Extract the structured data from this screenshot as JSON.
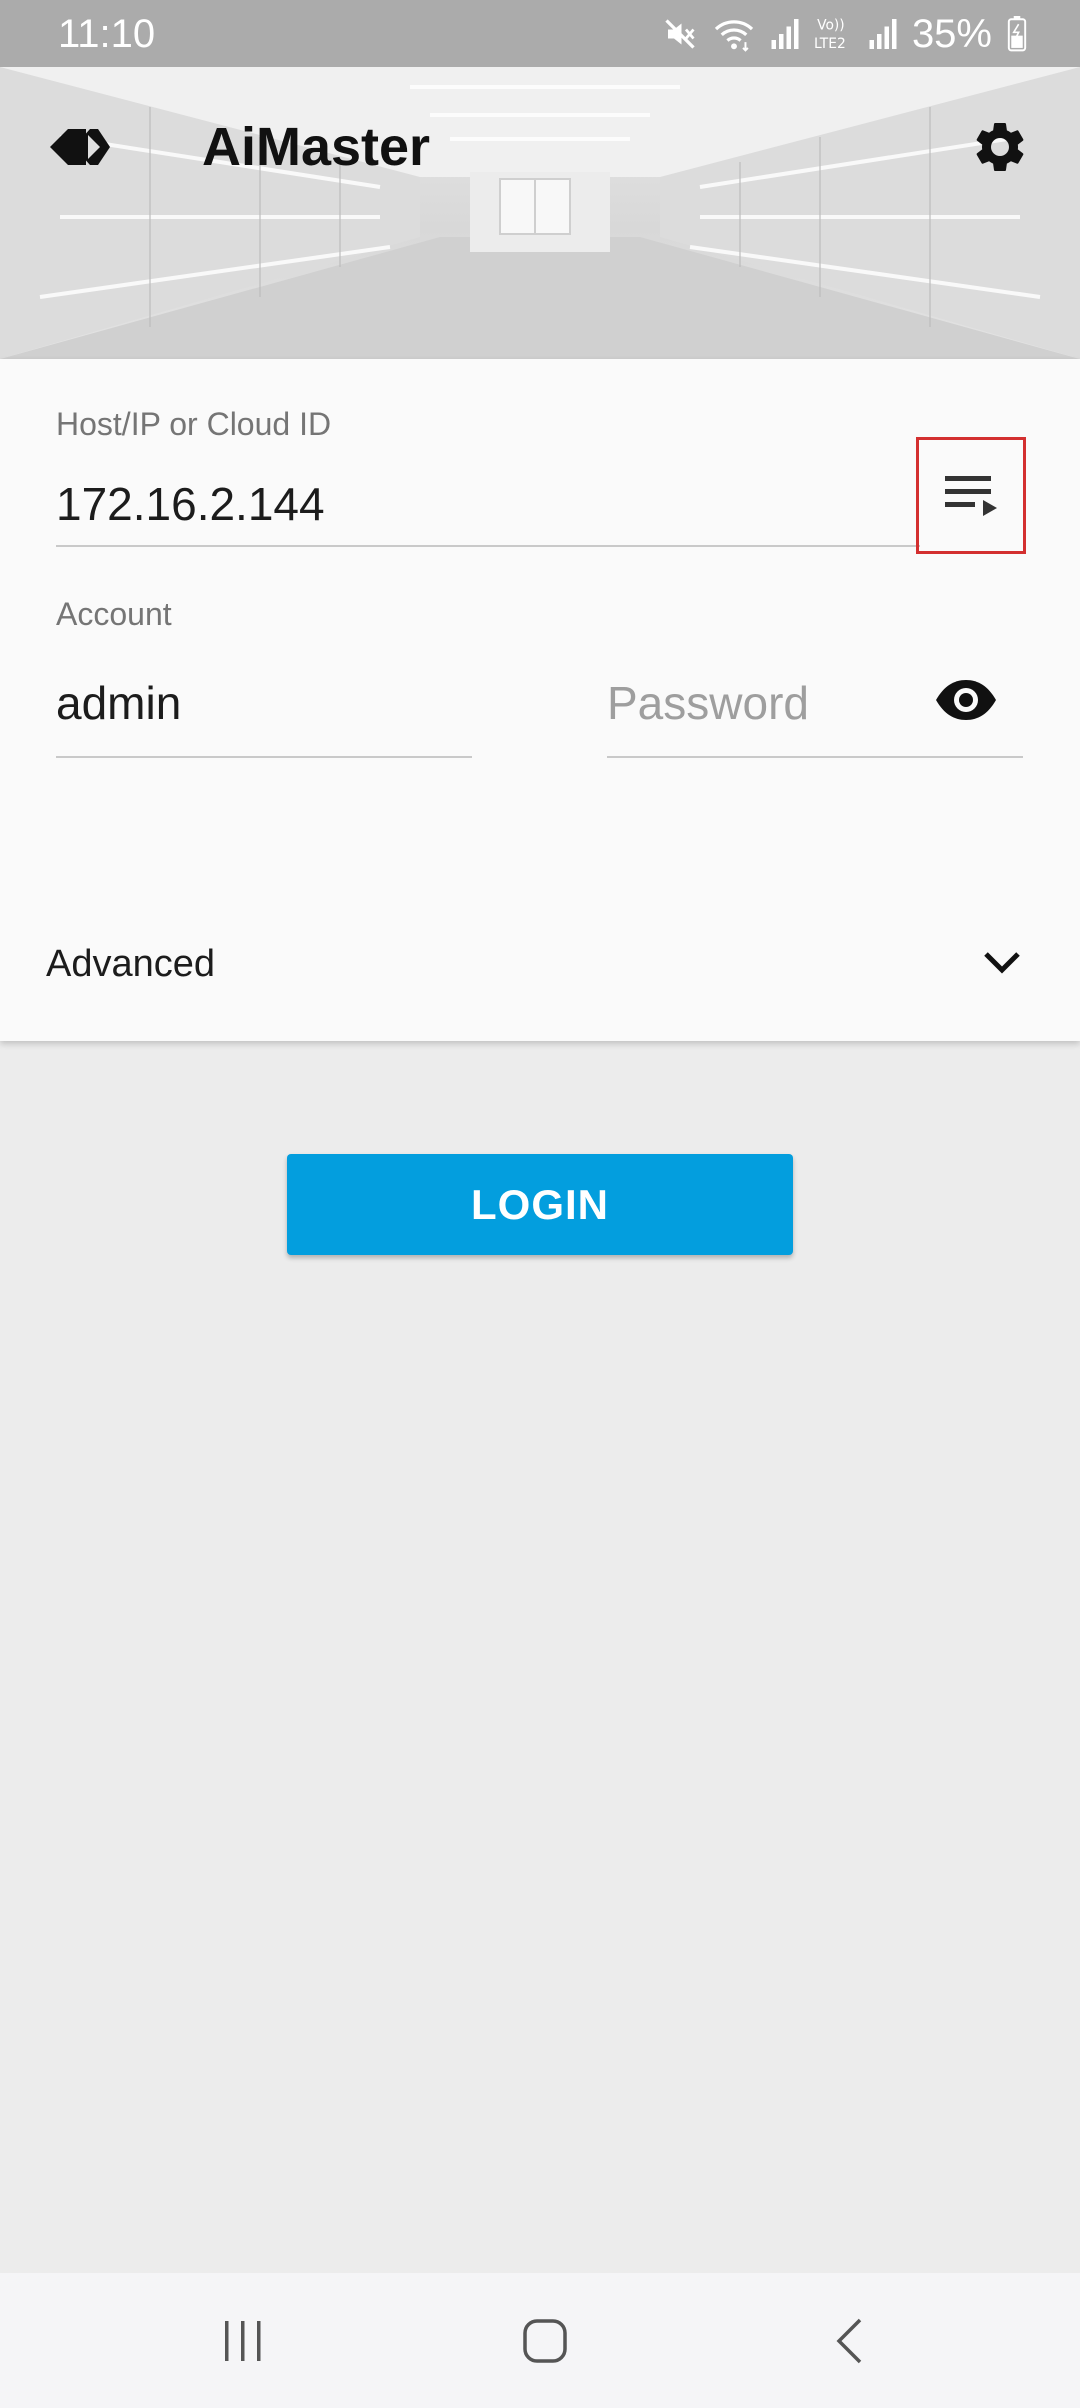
{
  "status_bar": {
    "time": "11:10",
    "battery": "35%",
    "icons": [
      "mute-icon",
      "wifi-icon",
      "signal-icon",
      "volte-icon",
      "signal-icon",
      "battery-icon"
    ]
  },
  "header": {
    "title": "AiMaster",
    "logo_icon": "aimaster-logo-icon",
    "settings_icon": "gear-icon"
  },
  "form": {
    "host": {
      "label": "Host/IP or Cloud ID",
      "value": "172.16.2.144",
      "list_icon": "playlist-icon"
    },
    "account": {
      "label": "Account",
      "value": "admin"
    },
    "password": {
      "placeholder": "Password",
      "toggle_icon": "eye-icon"
    },
    "advanced": {
      "label": "Advanced",
      "icon": "chevron-down-icon"
    }
  },
  "login": {
    "label": "LOGIN"
  },
  "colors": {
    "accent": "#039ede",
    "highlight_border": "#d32f2f",
    "status_bar": "#ababab"
  },
  "nav_bar": {
    "buttons": [
      "recent-apps-icon",
      "home-icon",
      "back-icon"
    ]
  }
}
